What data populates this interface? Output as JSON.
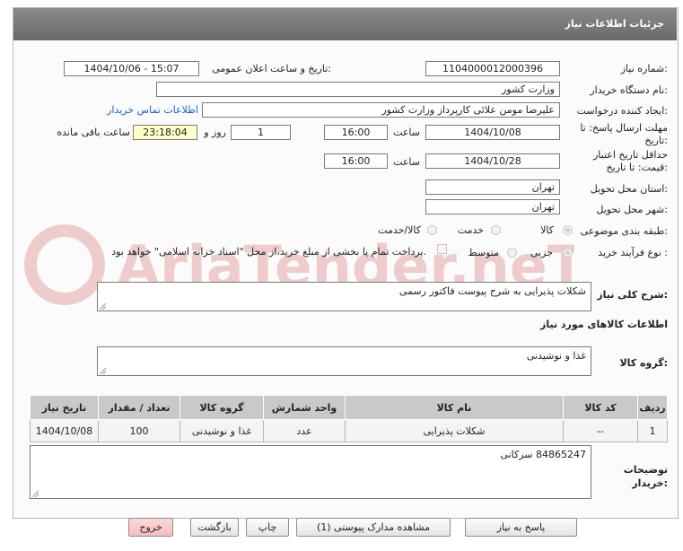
{
  "header": {
    "title": "جزئیات اطلاعات نیاز"
  },
  "form": {
    "need_number_label": "شماره نیاز:",
    "need_number": "1104000012000396",
    "announce_label": "تاریخ و ساعت اعلان عمومی:",
    "announce_value": "1404/10/06 - 15:07",
    "buyer_org_label": "نام دستگاه خریدار:",
    "buyer_org": "وزارت کشور",
    "creator_label": "ایجاد کننده درخواست:",
    "creator": "علیرضا مومن علائی کارپرداز وزارت کشور",
    "contact_link": "اطلاعات تماس خریدار",
    "reply_deadline_label_1": "مهلت ارسال پاسخ: تا",
    "reply_deadline_label_2": "تاریخ:",
    "reply_date": "1404/10/08",
    "time_label": "ساعت",
    "reply_time": "16:00",
    "days_value": "1",
    "days_label": "روز و",
    "remaining_time": "23:18:04",
    "remaining_label": "ساعت باقی مانده",
    "validity_label_1": "حداقل تاریخ اعتبار",
    "validity_label_2": "قیمت: تا تاریخ:",
    "validity_date": "1404/10/28",
    "validity_time": "16:00",
    "province_label": "استان محل تحویل:",
    "province": "تهران",
    "city_label": "شهر محل تحویل:",
    "city": "تهران",
    "category_label": "طبقه بندی موضوعی:",
    "category_options": [
      "کالا",
      "خدمت",
      "کالا/خدمت"
    ],
    "purchase_type_label": "نوع فرآیند خرید :",
    "purchase_options": [
      "جزیی",
      "متوسط"
    ],
    "payment_note": "پرداخت تمام یا بخشی از مبلغ خرید،از محل \"اسناد خزانه اسلامی\" خواهد بود."
  },
  "description": {
    "label": "شرح کلی نیاز:",
    "value": "شکلات پذیرایی به شرح پیوست فاکتور رسمی"
  },
  "goods_section": {
    "title": "اطلاعات کالاهای مورد نیاز",
    "group_label": "گروه کالا:",
    "group_value": "غذا و نوشیدنی"
  },
  "table": {
    "headers": [
      "ردیف",
      "کد کالا",
      "نام کالا",
      "واحد شمارش",
      "گروه کالا",
      "تعداد / مقدار",
      "تاریخ نیاز"
    ],
    "rows": [
      [
        "1",
        "--",
        "شکلات پذیرایی",
        "عدد",
        "غذا و نوشیدنی",
        "100",
        "1404/10/08"
      ]
    ]
  },
  "buyer_notes": {
    "label_1": "توضیحات",
    "label_2": "خریدار:",
    "value": "84865247 سرکانی"
  },
  "buttons": {
    "reply": "پاسخ به نیاز",
    "attachments": "مشاهده مدارک پیوستی (1)",
    "print": "چاپ",
    "back": "بازگشت",
    "exit": "خروج"
  },
  "watermark": {
    "text": "AriaTender.neT"
  }
}
